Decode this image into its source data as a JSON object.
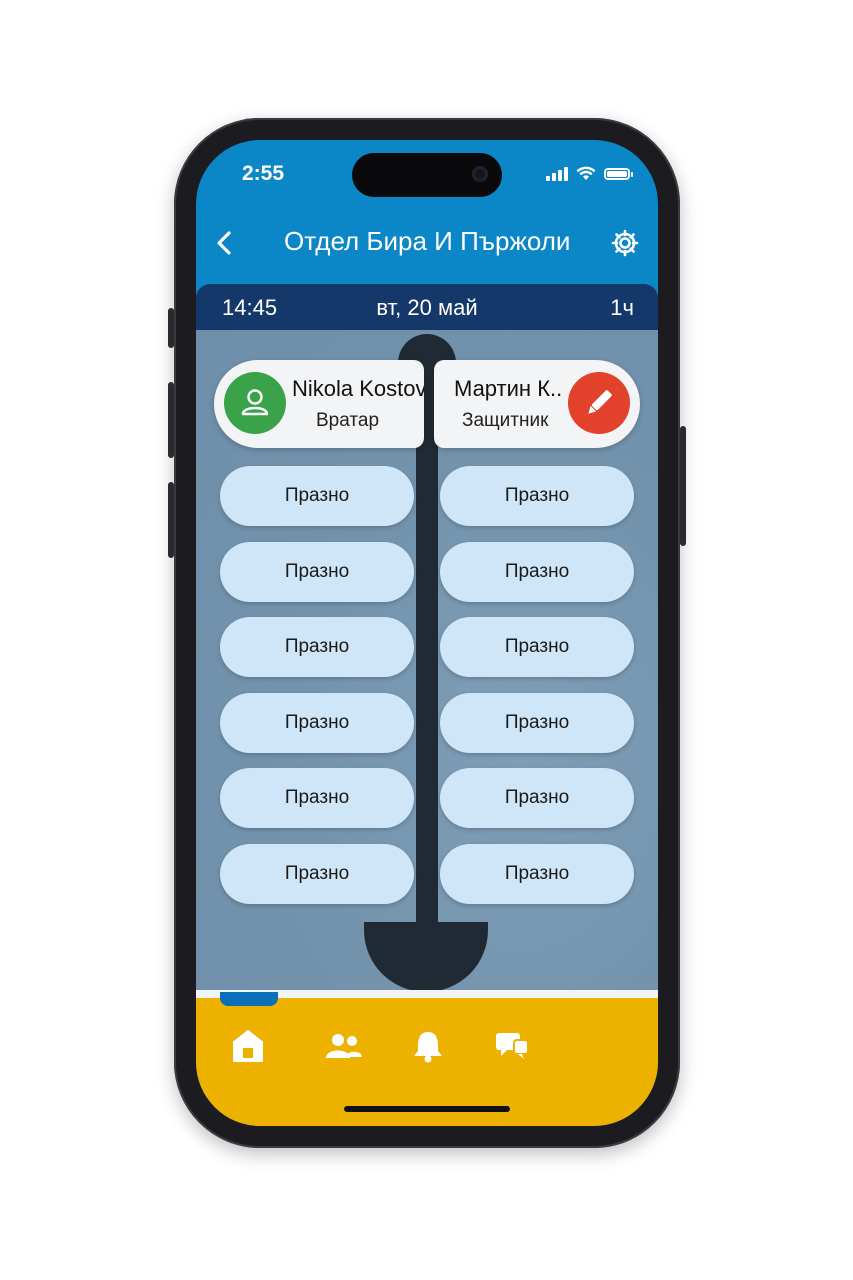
{
  "status_bar": {
    "time": "2:55"
  },
  "header": {
    "title": "Отдел Бира И Пържоли"
  },
  "info_bar": {
    "time": "14:45",
    "date": "вт, 20 май",
    "duration": "1ч"
  },
  "players": [
    {
      "name": "Nikola Kostov",
      "role": "Вратар",
      "avatar_icon": "person-icon",
      "color": "#3aa34a"
    },
    {
      "name": "Мартин К..",
      "role": "Защитник",
      "avatar_icon": "pencil-icon",
      "color": "#e2422c"
    }
  ],
  "slots": {
    "left": [
      "Празно",
      "Празно",
      "Празно",
      "Празно",
      "Празно",
      "Празно"
    ],
    "right": [
      "Празно",
      "Празно",
      "Празно",
      "Празно",
      "Празно",
      "Празно"
    ]
  },
  "nav": {
    "items": [
      "home-icon",
      "people-icon",
      "bell-icon",
      "chat-icon"
    ],
    "active": "home-icon"
  },
  "colors": {
    "header": "#0b86c6",
    "info_bar": "#15386a",
    "nav": "#edb100",
    "slot": "#cfe6f8"
  }
}
